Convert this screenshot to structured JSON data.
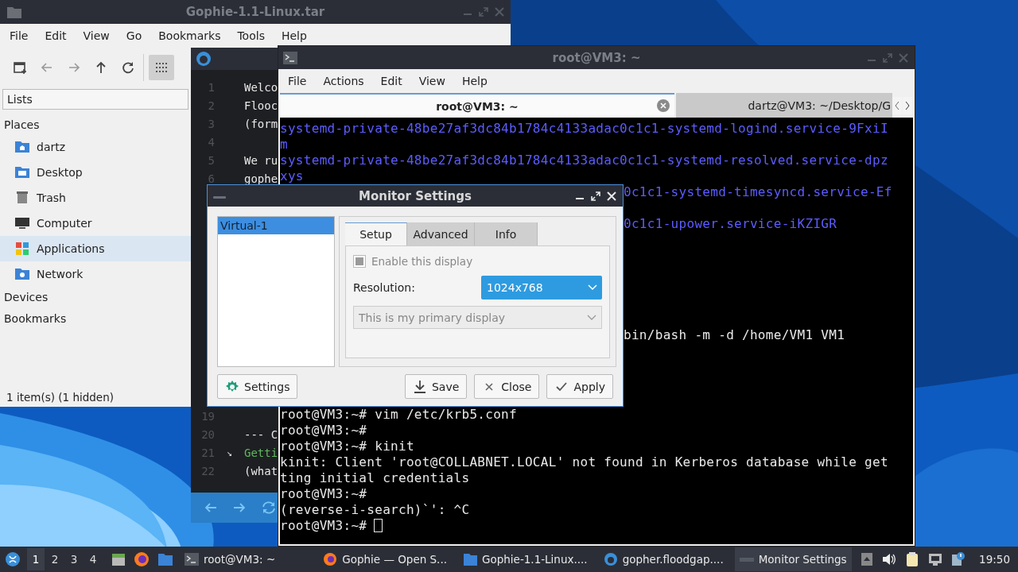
{
  "file_manager": {
    "title": "Gophie-1.1-Linux.tar",
    "menu": [
      "File",
      "Edit",
      "View",
      "Go",
      "Bookmarks",
      "Tools",
      "Help"
    ],
    "side_pane": {
      "mode": "Lists",
      "sections": [
        {
          "title": "Places",
          "items": [
            {
              "label": "dartz",
              "kind": "home",
              "selected": false
            },
            {
              "label": "Desktop",
              "kind": "desktop",
              "selected": false
            },
            {
              "label": "Trash",
              "kind": "trash",
              "selected": false
            },
            {
              "label": "Computer",
              "kind": "computer",
              "selected": false
            },
            {
              "label": "Applications",
              "kind": "apps",
              "selected": true
            },
            {
              "label": "Network",
              "kind": "network",
              "selected": false
            }
          ]
        },
        {
          "title": "Devices"
        },
        {
          "title": "Bookmarks"
        }
      ]
    },
    "status_bar": "1 item(s) (1 hidden)"
  },
  "editor": {
    "lines_top": [
      {
        "number": "1",
        "text": "Welco",
        "kind": "plain"
      },
      {
        "number": "2",
        "text": "Flooc",
        "kind": "plain"
      },
      {
        "number": "3",
        "text": "(form",
        "kind": "plain"
      },
      {
        "number": "4"
      },
      {
        "number": "5",
        "text": "We ru",
        "kind": "plain"
      },
      {
        "number": "6",
        "text": "gophe",
        "kind": "plain"
      }
    ],
    "lines_bottom": [
      {
        "number": "19"
      },
      {
        "number": "20",
        "text": "--- C",
        "kind": "plain"
      },
      {
        "number": "21",
        "text": "Getti",
        "kind": "link",
        "marker": "↘"
      },
      {
        "number": "22",
        "text": "(what",
        "kind": "plain"
      }
    ]
  },
  "terminal": {
    "title": "root@VM3: ~",
    "menu": [
      "File",
      "Actions",
      "Edit",
      "View",
      "Help"
    ],
    "tabs": [
      {
        "label": "root@VM3: ~",
        "selected": true
      },
      {
        "label": "dartz@VM3: ~/Desktop/G",
        "selected": false
      }
    ],
    "lines": [
      {
        "text": "systemd-private-48be27af3dc84b1784c4133adac0c1c1-systemd-logind.service-9FxiI",
        "kind": "dir"
      },
      {
        "text": "m",
        "kind": "dir"
      },
      {
        "text": "systemd-private-48be27af3dc84b1784c4133adac0c1c1-systemd-resolved.service-dpz",
        "kind": "dir"
      },
      {
        "text": "xys",
        "kind": "dir"
      },
      {
        "text": "0c1c1-systemd-timesyncd.service-Ef",
        "kind": "dir",
        "behind_dialog": true
      },
      {
        "kind": "blank"
      },
      {
        "text": "0c1c1-upower.service-iKZIGR",
        "kind": "dir",
        "behind_dialog": true
      },
      {
        "kind": "blank"
      },
      {
        "kind": "blank"
      },
      {
        "kind": "blank"
      },
      {
        "kind": "blank"
      },
      {
        "kind": "blank"
      },
      {
        "kind": "blank"
      },
      {
        "text": "bin/bash -m -d /home/VM1 VM1",
        "kind": "plain",
        "behind_dialog": true
      },
      {
        "kind": "blank"
      },
      {
        "kind": "blank"
      },
      {
        "kind": "blank"
      },
      {
        "kind": "blank"
      },
      {
        "text": "root@VM3:~# vim /etc/krb5.conf",
        "kind": "plain"
      },
      {
        "text": "root@VM3:~#",
        "kind": "plain"
      },
      {
        "text": "root@VM3:~# kinit",
        "kind": "plain"
      },
      {
        "text": "kinit: Client 'root@COLLABNET.LOCAL' not found in Kerberos database while get",
        "kind": "plain"
      },
      {
        "text": "ting initial credentials",
        "kind": "plain"
      },
      {
        "text": "root@VM3:~#",
        "kind": "plain"
      },
      {
        "text": "(reverse-i-search)`': ^C",
        "kind": "plain"
      },
      {
        "text": "root@VM3:~#",
        "kind": "plain",
        "cursor": true
      }
    ]
  },
  "dialog": {
    "title": "Monitor Settings",
    "outputs": [
      {
        "label": "Virtual-1",
        "selected": true
      }
    ],
    "tabs": [
      {
        "label": "Setup",
        "selected": true
      },
      {
        "label": "Advanced",
        "selected": false
      },
      {
        "label": "Info",
        "selected": false
      }
    ],
    "enable": {
      "label": "Enable this display",
      "checked": true,
      "disabled": true
    },
    "resolution": {
      "label": "Resolution:",
      "value": "1024x768"
    },
    "primary": {
      "value": "This is my primary display",
      "disabled": true
    },
    "buttons": [
      {
        "label": "Settings",
        "kind": "settings"
      },
      {
        "label": "Save",
        "kind": "save"
      },
      {
        "label": "Close",
        "kind": "close"
      },
      {
        "label": "Apply",
        "kind": "apply"
      }
    ]
  },
  "taskbar": {
    "workspaces": [
      {
        "label": "1",
        "selected": true
      },
      {
        "label": "2",
        "selected": false
      },
      {
        "label": "3",
        "selected": false
      },
      {
        "label": "4",
        "selected": false
      }
    ],
    "tasks": [
      {
        "label": "root@VM3: ~",
        "kind": "terminal",
        "active": false
      },
      {
        "label": "Gophie — Open S...",
        "kind": "browser",
        "active": false
      },
      {
        "label": "Gophie-1.1-Linux....",
        "kind": "folder",
        "active": false
      },
      {
        "label": "gopher.floodgap....",
        "kind": "github",
        "active": false
      },
      {
        "label": "Monitor Settings",
        "kind": "dialog",
        "active": true
      }
    ],
    "clock": "19:50"
  }
}
